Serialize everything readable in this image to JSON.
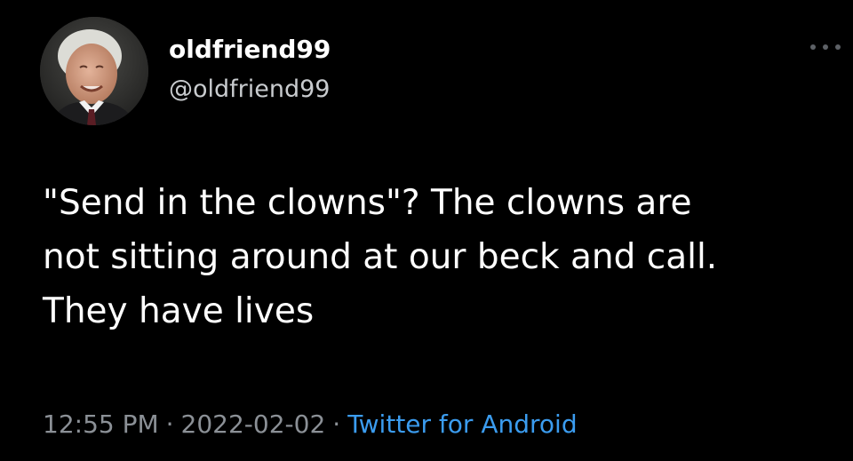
{
  "user": {
    "display_name": "oldfriend99",
    "handle": "@oldfriend99"
  },
  "tweet": {
    "lines": [
      "\"Send in the clowns\"? The clowns are",
      "not sitting around at our beck and call.",
      "They have lives"
    ]
  },
  "meta": {
    "time": "12:55 PM",
    "separator": "·",
    "date": "2022-02-02",
    "source": "Twitter for Android"
  },
  "icons": {
    "more": "more-options-icon",
    "avatar": "avatar"
  },
  "colors": {
    "background": "#000000",
    "text": "#ffffff",
    "muted": "#8b9096",
    "link": "#3b9cef"
  }
}
